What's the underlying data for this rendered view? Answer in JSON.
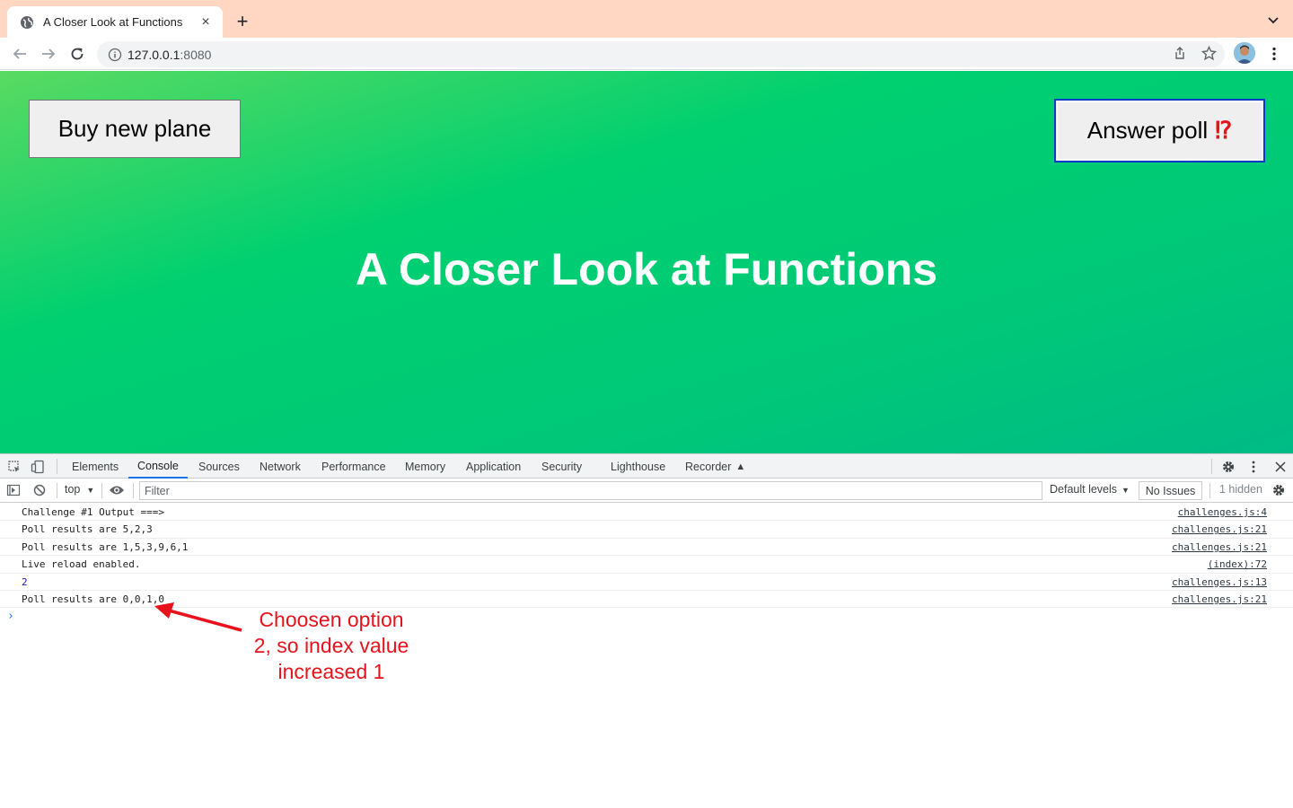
{
  "browser": {
    "tab_title": "A Closer Look at Functions",
    "url_host": "127.0.0.1",
    "url_port": ":8080"
  },
  "page": {
    "buy_button": "Buy new plane",
    "poll_button": "Answer poll",
    "poll_emoji": "⁉",
    "heading": "A Closer Look at Functions",
    "colors": {
      "gradient_start": "#5ada62",
      "gradient_end": "#00bb86"
    }
  },
  "devtools": {
    "tabs": [
      "Elements",
      "Console",
      "Sources",
      "Network",
      "Performance",
      "Memory",
      "Application",
      "Security",
      "Lighthouse",
      "Recorder"
    ],
    "active_tab": "Console",
    "context": "top",
    "filter_placeholder": "Filter",
    "levels": "Default levels",
    "issues": "No Issues",
    "hidden": "1 hidden",
    "console_rows": [
      {
        "message": "Challenge #1 Output ===>",
        "source": "challenges.js:4"
      },
      {
        "message": "Poll results are 5,2,3",
        "source": "challenges.js:21"
      },
      {
        "message": "Poll results are 1,5,3,9,6,1",
        "source": "challenges.js:21"
      },
      {
        "message": "Live reload enabled.",
        "source": "(index):72"
      },
      {
        "message": "2",
        "source": "challenges.js:13"
      },
      {
        "message": "Poll results are 0,0,1,0",
        "source": "challenges.js:21"
      }
    ]
  },
  "annotation": {
    "text_lines": [
      "Choosen option",
      "2, so index value",
      "increased 1"
    ],
    "color": "#e8121c"
  }
}
